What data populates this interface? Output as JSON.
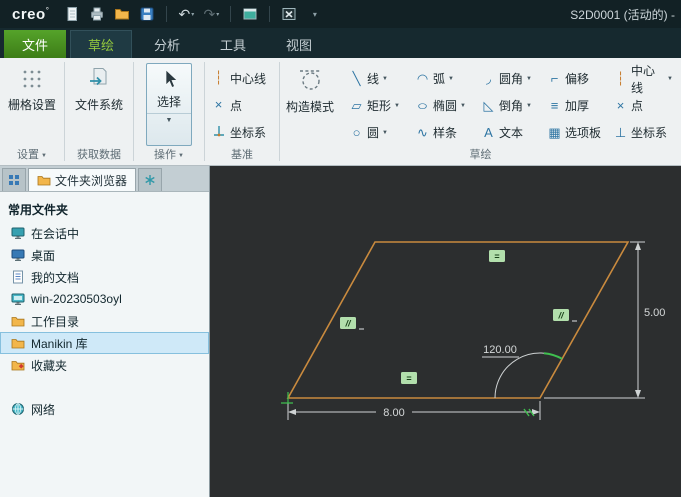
{
  "titlebar": {
    "logo": "creo",
    "title": "S2D0001 (活动的) -",
    "icons": [
      "new-file",
      "print",
      "open-folder",
      "save",
      "undo",
      "redo",
      "window-switch",
      "close-window",
      "toolbar-options"
    ]
  },
  "menu_tabs": [
    {
      "label": "文件"
    },
    {
      "label": "草绘",
      "active": true
    },
    {
      "label": "分析"
    },
    {
      "label": "工具"
    },
    {
      "label": "视图"
    }
  ],
  "ribbon": {
    "settings": {
      "button": "栅格设置",
      "caption": "设置",
      "has_menu": true
    },
    "get_data": {
      "button": "文件系统",
      "caption": "获取数据",
      "has_menu": false
    },
    "operations": {
      "button": "选择",
      "caption": "操作",
      "has_menu": true
    },
    "datum": {
      "caption": "基准",
      "items": [
        {
          "label": "中心线",
          "icon": "centerline-icon"
        },
        {
          "label": "点",
          "icon": "point-icon"
        },
        {
          "label": "坐标系",
          "icon": "csys-icon"
        }
      ]
    },
    "sketch": {
      "caption": "草绘",
      "construction": "构造模式",
      "buttons": [
        {
          "label": "线",
          "glyph": "╲",
          "dropdown": true
        },
        {
          "label": "矩形",
          "glyph": "▱",
          "dropdown": true
        },
        {
          "label": "圆",
          "glyph": "○",
          "dropdown": true
        },
        {
          "label": "弧",
          "glyph": "◠",
          "dropdown": true
        },
        {
          "label": "椭圆",
          "glyph": "○",
          "dropdown": true
        },
        {
          "label": "样条",
          "glyph": "∿",
          "dropdown": false
        },
        {
          "label": "圆角",
          "glyph": "◞",
          "dropdown": true
        },
        {
          "label": "倒角",
          "glyph": "◺",
          "dropdown": true
        },
        {
          "label": "文本",
          "glyph": "A",
          "dropdown": false
        },
        {
          "label": "偏移",
          "glyph": "⌐",
          "dropdown": false
        },
        {
          "label": "加厚",
          "glyph": "≡",
          "dropdown": false
        },
        {
          "label": "选项板",
          "glyph": "▦",
          "dropdown": false
        },
        {
          "label": "中心线",
          "glyph": "┆",
          "dropdown": true
        },
        {
          "label": "点",
          "glyph": "×",
          "dropdown": false
        },
        {
          "label": "坐标系",
          "glyph": "⊥",
          "dropdown": false
        }
      ]
    }
  },
  "sidebar": {
    "tabs": {
      "browser_label": "文件夹浏览器"
    },
    "header": "常用文件夹",
    "items": [
      {
        "label": "在会话中",
        "icon": "monitor-icon"
      },
      {
        "label": "桌面",
        "icon": "desktop-icon"
      },
      {
        "label": "我的文档",
        "icon": "document-icon"
      },
      {
        "label": "win-20230503oyl",
        "icon": "computer-icon"
      },
      {
        "label": "工作目录",
        "icon": "folder-icon"
      },
      {
        "label": "Manikin 库",
        "icon": "folder-icon",
        "selected": true
      },
      {
        "label": "收藏夹",
        "icon": "favorites-folder-icon"
      }
    ],
    "network_label": "网络"
  },
  "sketch": {
    "dim_height": "5.00",
    "dim_width": "8.00",
    "dim_angle": "120.00",
    "constraint_equal": "=",
    "constraint_parallel": "//"
  },
  "colors": {
    "file_tab_green": "#3d7d17",
    "active_tab_text": "#93c83d",
    "sketch_line": "#c98a3e",
    "constraint_bg": "#b2dfac",
    "selection_bg": "#cfe9f8",
    "canvas_bg": "#2c2e2f"
  }
}
